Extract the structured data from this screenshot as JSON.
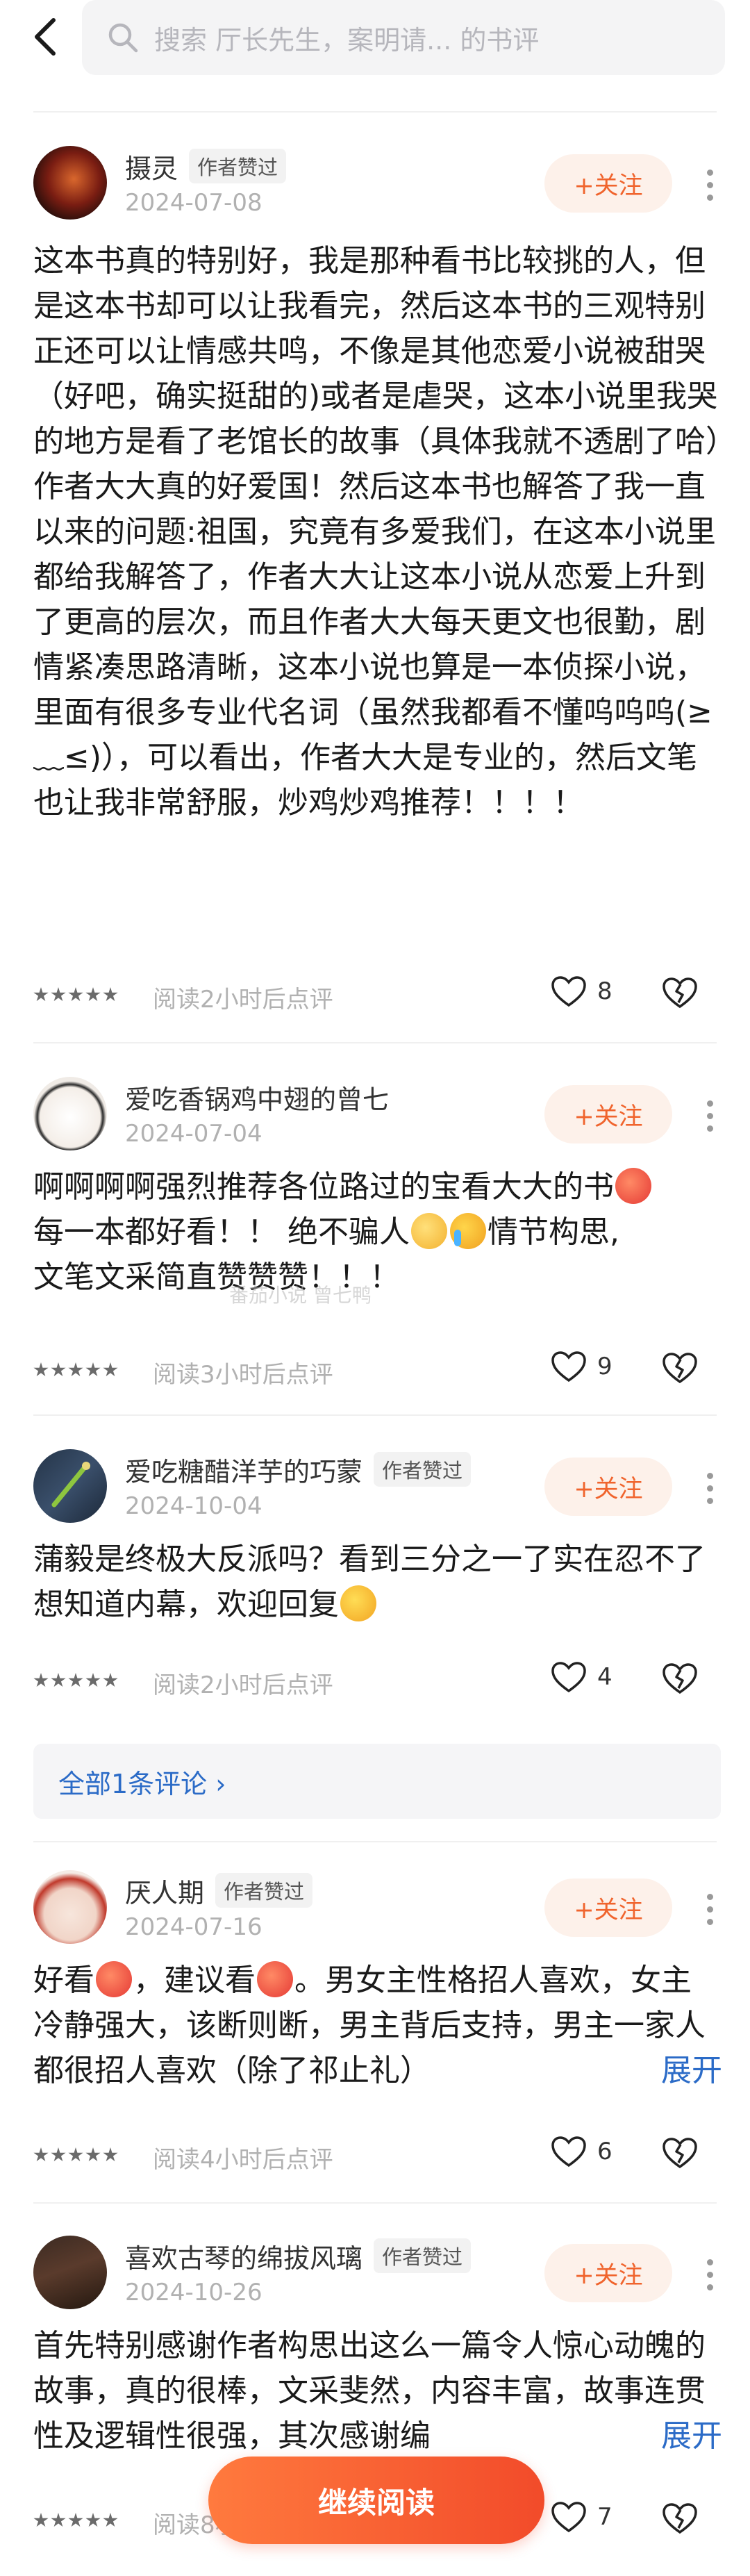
{
  "search": {
    "placeholder": "搜索 厅长先生，案明请... 的书评"
  },
  "labels": {
    "follow": "+关注",
    "author_liked": "作者赞过",
    "expand": "展开",
    "continue": "继续阅读",
    "all_comments": "全部1条评论 ›"
  },
  "reviews": [
    {
      "user": "摄灵",
      "author_liked": true,
      "date": "2024-07-08",
      "text": "这本书真的特别好，我是那种看书比较挑的人，但是这本书却可以让我看完，然后这本书的三观特别正还可以让情感共鸣，不像是其他恋爱小说被甜哭（好吧，确实挺甜的)或者是虐哭，这本小说里我哭的地方是看了老馆长的故事（具体我就不透剧了哈）作者大大真的好爱国！然后这本书也解答了我一直以来的问题:祖国，究竟有多爱我们，在这本小说里都给我解答了，作者大大让这本小说从恋爱上升到了更高的层次，而且作者大大每天更文也很勤，剧情紧凑思路清晰，这本小说也算是一本侦探小说，里面有很多专业代名词（虽然我都看不懂呜呜呜(≥﹏≤)），可以看出，作者大大是专业的，然后文笔也让我非常舒服，炒鸡炒鸡推荐！！！！",
      "read": "阅读2小时后点评",
      "likes": "8"
    },
    {
      "user": "爱吃香锅鸡中翅的曾七",
      "author_liked": false,
      "date": "2024-07-04",
      "text_a": "啊啊啊啊强烈推荐各位路过的宝看大大的书",
      "text_b": "每一本都好看！！ 绝不骗人",
      "text_c": "情节构思,",
      "text_d": "文笔文采简直赞赞赞！！！",
      "read": "阅读3小时后点评",
      "likes": "9"
    },
    {
      "user": "爱吃糖醋洋芋的巧蒙",
      "author_liked": true,
      "date": "2024-10-04",
      "text": "蒲毅是终极大反派吗？看到三分之一了实在忍不了想知道内幕，欢迎回复",
      "read": "阅读2小时后点评",
      "likes": "4"
    },
    {
      "user": "厌人期",
      "author_liked": true,
      "date": "2024-07-16",
      "text_a": "好看",
      "text_b": "，建议看",
      "text_c": "。男女主性格招人喜欢，女主冷静强大，该断则断，男主背后支持，男主一家人都很招人喜欢（除了祁止礼）",
      "read": "阅读4小时后点评",
      "likes": "6"
    },
    {
      "user": "喜欢古琴的绵拔风璃",
      "author_liked": true,
      "date": "2024-10-26",
      "text": "首先特别感谢作者构思出这么一篇令人惊心动魄的故事，真的很棒，文采斐然，内容丰富，故事连贯性及逻辑性很强，其次感谢编",
      "read": "阅读8小时后点评",
      "likes": "7"
    }
  ],
  "watermark": "番茄小说 曾七鸭"
}
